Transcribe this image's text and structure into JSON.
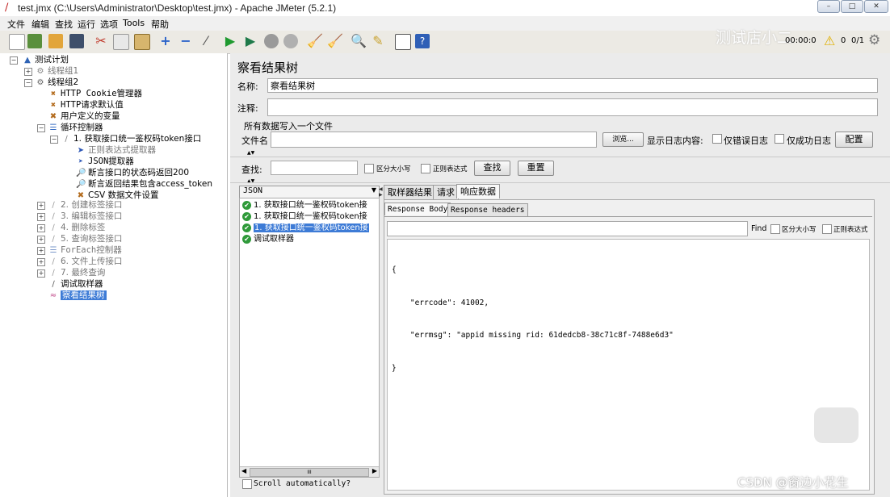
{
  "window": {
    "title": "test.jmx (C:\\Users\\Administrator\\Desktop\\test.jmx) - Apache JMeter (5.2.1)",
    "min_label": "–",
    "max_label": "□",
    "close_label": "✕"
  },
  "menu": [
    "文件",
    "编辑",
    "查找",
    "运行",
    "选项",
    "Tools",
    "帮助"
  ],
  "toolbar": {
    "timer": "00:00:0",
    "warnings": "0",
    "threads": "0/1",
    "watermark": "测试店小二"
  },
  "tree": [
    {
      "label": "测试计划",
      "icon": "test-plan-icon",
      "dim": false
    },
    {
      "label": "线程组1",
      "icon": "thread-group-icon",
      "dim": true
    },
    {
      "label": "线程组2",
      "icon": "thread-group-icon",
      "dim": false
    },
    {
      "label": "HTTP Cookie管理器",
      "icon": "wrench-icon",
      "dim": false
    },
    {
      "label": "HTTP请求默认值",
      "icon": "wrench-icon",
      "dim": false
    },
    {
      "label": "用户定义的变量",
      "icon": "wrench-icon",
      "dim": false
    },
    {
      "label": "循环控制器",
      "icon": "loop-controller-icon",
      "dim": false
    },
    {
      "label": "1. 获取接口统一鉴权码token接口",
      "icon": "sampler-icon",
      "dim": false
    },
    {
      "label": "正则表达式提取器",
      "icon": "extractor-icon",
      "dim": true
    },
    {
      "label": "JSON提取器",
      "icon": "extractor-icon",
      "dim": false
    },
    {
      "label": "断言接口的状态码返回200",
      "icon": "assertion-icon",
      "dim": false
    },
    {
      "label": "断言返回结果包含access_token",
      "icon": "assertion-icon",
      "dim": false
    },
    {
      "label": "CSV 数据文件设置",
      "icon": "wrench-icon",
      "dim": false
    },
    {
      "label": "2. 创建标签接口",
      "icon": "sampler-icon",
      "dim": true
    },
    {
      "label": "3. 编辑标签接口",
      "icon": "sampler-icon",
      "dim": true
    },
    {
      "label": "4. 删除标签",
      "icon": "sampler-icon",
      "dim": true
    },
    {
      "label": "5. 查询标签接口",
      "icon": "sampler-icon",
      "dim": true
    },
    {
      "label": "ForEach控制器",
      "icon": "foreach-icon",
      "dim": true
    },
    {
      "label": "6. 文件上传接口",
      "icon": "sampler-icon",
      "dim": true
    },
    {
      "label": "7. 最终查询",
      "icon": "sampler-icon",
      "dim": true
    },
    {
      "label": "调试取样器",
      "icon": "sampler-icon",
      "dim": false
    },
    {
      "label": "察看结果树",
      "icon": "results-tree-icon",
      "dim": false
    }
  ],
  "panel": {
    "title": "察看结果树",
    "name_label": "名称:",
    "name_value": "察看结果树",
    "comment_label": "注释:",
    "comment_value": "",
    "write_all_label": "所有数据写入一个文件",
    "filename_label": "文件名",
    "filename_value": "",
    "browse_label": "浏览...",
    "log_content_label": "显示日志内容:",
    "errors_only_label": "仅错误日志",
    "success_only_label": "仅成功日志",
    "configure_label": "配置",
    "search_label": "查找:",
    "search_value": "",
    "case_sensitive_label": "区分大小写",
    "regex_label": "正则表达式",
    "find_button": "查找",
    "reset_button": "重置"
  },
  "renderer": {
    "selected": "JSON"
  },
  "results": [
    {
      "label": "1. 获取接口统一鉴权码token接",
      "selected": false
    },
    {
      "label": "1. 获取接口统一鉴权码token接",
      "selected": false
    },
    {
      "label": "1. 获取接口统一鉴权码token接",
      "selected": true
    },
    {
      "label": "调试取样器",
      "selected": false
    }
  ],
  "tabs": [
    "取样器结果",
    "请求",
    "响应数据"
  ],
  "subtabs": [
    "Response Body",
    "Response headers"
  ],
  "find": {
    "label": "Find",
    "case_label": "区分大小写",
    "regex_label": "正则表达式",
    "value": ""
  },
  "response_body": [
    "{",
    "    \"errcode\": 41002,",
    "    \"errmsg\": \"appid missing rid: 61dedcb8-38c71c8f-7488e6d3\"",
    "}"
  ],
  "scroll_auto_label": "Scroll automatically?",
  "hscroll_label": "III",
  "watermark_csdn": "CSDN @窗边小花生"
}
